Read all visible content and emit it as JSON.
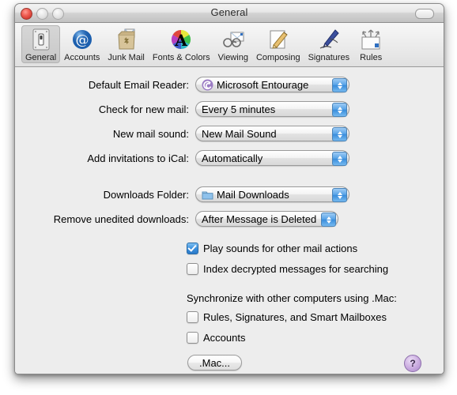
{
  "window": {
    "title": "General",
    "controls": {
      "close": "close-button",
      "minimize": "minimize-button",
      "zoom": "zoom-button"
    },
    "toolbar_toggle": "toolbar-toggle-button"
  },
  "toolbar": {
    "items": [
      {
        "label": "General",
        "icon": "general-switchplate-icon",
        "selected": true
      },
      {
        "label": "Accounts",
        "icon": "at-sign-icon",
        "selected": false
      },
      {
        "label": "Junk Mail",
        "icon": "junk-mail-bag-icon",
        "selected": false
      },
      {
        "label": "Fonts & Colors",
        "icon": "color-wheel-a-icon",
        "selected": false
      },
      {
        "label": "Viewing",
        "icon": "glasses-envelope-icon",
        "selected": false
      },
      {
        "label": "Composing",
        "icon": "pencil-paper-icon",
        "selected": false
      },
      {
        "label": "Signatures",
        "icon": "fountain-pen-icon",
        "selected": false
      },
      {
        "label": "Rules",
        "icon": "rules-arrows-icon",
        "selected": false
      }
    ]
  },
  "settings": {
    "rows": [
      {
        "label": "Default Email Reader:",
        "value": "Microsoft Entourage",
        "icon": "entourage-swirl-icon"
      },
      {
        "label": "Check for new mail:",
        "value": "Every 5 minutes",
        "icon": null
      },
      {
        "label": "New mail sound:",
        "value": "New Mail Sound",
        "icon": null
      },
      {
        "label": "Add invitations to iCal:",
        "value": "Automatically",
        "icon": null
      },
      {
        "label": "Downloads Folder:",
        "value": "Mail Downloads",
        "icon": "blue-folder-icon"
      },
      {
        "label": "Remove unedited downloads:",
        "value": "After Message is Deleted",
        "icon": null
      }
    ],
    "checkboxes": [
      {
        "label": "Play sounds for other mail actions",
        "checked": true
      },
      {
        "label": "Index decrypted messages for searching",
        "checked": false
      }
    ],
    "sync_heading": "Synchronize with other computers using .Mac:",
    "sync_checkboxes": [
      {
        "label": "Rules, Signatures, and Smart Mailboxes",
        "checked": false
      },
      {
        "label": "Accounts",
        "checked": false
      }
    ],
    "mac_button": ".Mac...",
    "help_button": "?"
  },
  "colors": {
    "accent_blue": "#3b8fdd",
    "window_bg": "#ededed",
    "help_purple": "#c9aadf",
    "close_red": "#f06055"
  }
}
